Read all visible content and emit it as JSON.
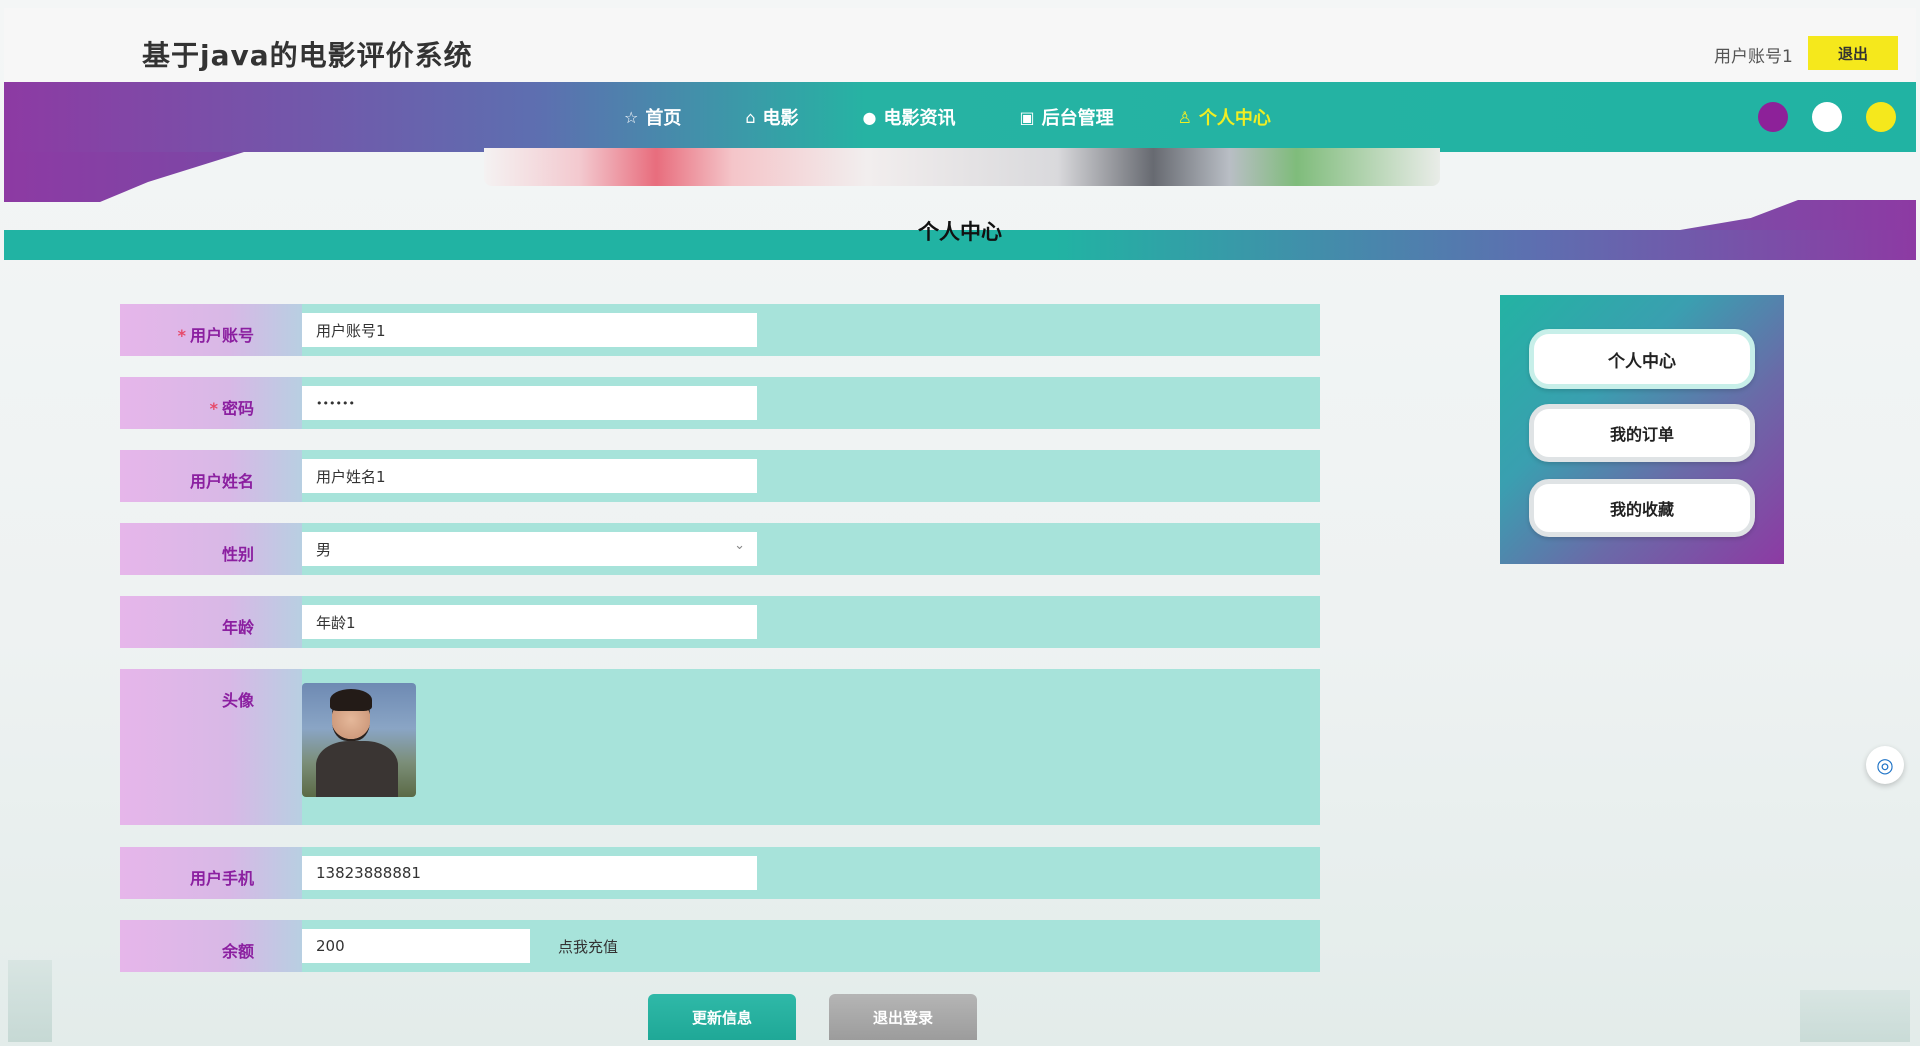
{
  "header": {
    "title": "基于java的电影评价系统",
    "user_account": "用户账号1",
    "logout_label": "退出"
  },
  "nav": {
    "items": [
      {
        "icon": "☆",
        "icon_name": "star-icon",
        "label": "首页"
      },
      {
        "icon": "⌂",
        "icon_name": "home-icon",
        "label": "电影"
      },
      {
        "icon": "●",
        "icon_name": "info-icon",
        "label": "电影资讯"
      },
      {
        "icon": "▣",
        "icon_name": "admin-icon",
        "label": "后台管理"
      },
      {
        "icon": "♙",
        "icon_name": "user-icon",
        "label": "个人中心"
      }
    ],
    "active_index": 4,
    "theme_dots": [
      "#8d2199",
      "#ffffff",
      "#f5e81c"
    ],
    "active_color": "#f1ee22"
  },
  "page": {
    "section_title": "个人中心"
  },
  "form": {
    "fields": [
      {
        "label": "用户账号",
        "required": true,
        "value": "用户账号1"
      },
      {
        "label": "密码",
        "required": true,
        "value": "••••••"
      },
      {
        "label": "用户姓名",
        "required": false,
        "value": "用户姓名1"
      },
      {
        "label": "性别",
        "required": false,
        "value": "男",
        "type": "select"
      },
      {
        "label": "年龄",
        "required": false,
        "value": "年龄1"
      },
      {
        "label": "头像",
        "required": false,
        "type": "image"
      },
      {
        "label": "用户手机",
        "required": false,
        "value": "13823888881"
      },
      {
        "label": "余额",
        "required": false,
        "value": "200"
      }
    ],
    "recharge_label": "点我充值",
    "update_label": "更新信息",
    "logout_label": "退出登录"
  },
  "side_menu": {
    "items": [
      "个人中心",
      "我的订单",
      "我的收藏"
    ],
    "active_index": 0
  },
  "colors": {
    "teal": "#21b3a3",
    "purple": "#8d3aa3",
    "yellow": "#f5e81c",
    "label_text": "#8b1fa0"
  }
}
